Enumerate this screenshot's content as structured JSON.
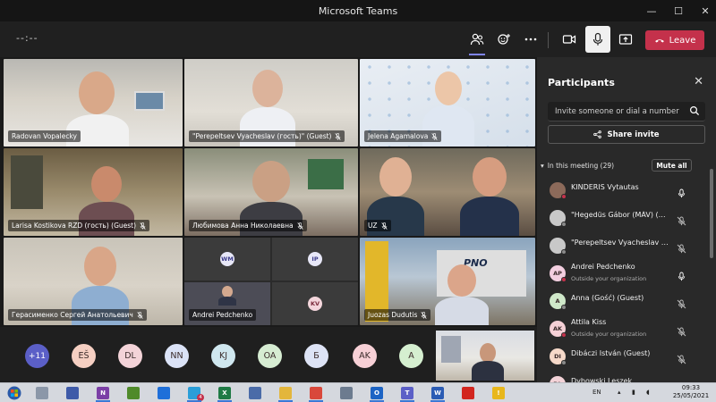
{
  "window": {
    "title": "Microsoft Teams",
    "controls": {
      "minimize": "—",
      "maximize": "☐",
      "close": "✕"
    }
  },
  "toolbar": {
    "timer": "--:--",
    "leave_label": "Leave",
    "icons": [
      "participants-icon",
      "reactions-icon",
      "more-icon",
      "camera-icon",
      "microphone-icon",
      "share-screen-icon"
    ]
  },
  "tiles": [
    {
      "name": "Radovan Vopalecky",
      "muted": false
    },
    {
      "name": "\"Perepeltsev Vyacheslav (гость)\" (Guest)",
      "muted": true
    },
    {
      "name": "Jelena Agamalova",
      "muted": true
    },
    {
      "name": "Larisa Kostikova RZD (гость) (Guest)",
      "muted": true
    },
    {
      "name": "Любимова Анна Николаевна",
      "muted": true
    },
    {
      "name": "UZ",
      "muted": true
    },
    {
      "name": "Герасименко Сергей Анатольевич",
      "muted": true
    },
    {
      "name": "Andrei Pedchenko",
      "muted": false
    },
    {
      "name": "Juozas Dudutis",
      "muted": true
    }
  ],
  "mini_tiles": [
    "WM",
    "IP",
    "KV"
  ],
  "pno_logo": "PNO",
  "strip": [
    {
      "initials": "+11",
      "color": "#5b5fc7"
    },
    {
      "initials": "EŠ",
      "color": "#f5cfc2"
    },
    {
      "initials": "DL",
      "color": "#f3d3d8"
    },
    {
      "initials": "NN",
      "color": "#dbe3f7"
    },
    {
      "initials": "KJ",
      "color": "#cfe7ef"
    },
    {
      "initials": "OA",
      "color": "#d6ecd2"
    },
    {
      "initials": "Б",
      "color": "#dde3f5"
    },
    {
      "initials": "AK",
      "color": "#f7d0d6"
    },
    {
      "initials": "A",
      "color": "#d5efd0"
    }
  ],
  "panel": {
    "title": "Participants",
    "search_placeholder": "Invite someone or dial a number",
    "share_invite": "Share invite",
    "section_label": "In this meeting (29)",
    "mute_all": "Mute all",
    "participants": [
      {
        "name": "KINDERIS Vytautas",
        "sub": "",
        "initials": "",
        "avatar_color": "#8c6a5a",
        "dot": "#c4314b",
        "mic": "on"
      },
      {
        "name": "\"Hegedüs Gábor (MÁV) (G…",
        "sub": "",
        "initials": "",
        "avatar_color": "#c8c8c8",
        "dot": "#8a8a8a",
        "mic": "off"
      },
      {
        "name": "\"Perepeltsev Vyacheslav (г…",
        "sub": "",
        "initials": "",
        "avatar_color": "#c8c8c8",
        "dot": "#8a8a8a",
        "mic": "off"
      },
      {
        "name": "Andrei Pedchenko",
        "sub": "Outside your organization",
        "initials": "AP",
        "avatar_color": "#f3cfe0",
        "dot": "#c4314b",
        "mic": "on"
      },
      {
        "name": "Anna (Gość) (Guest)",
        "sub": "",
        "initials": "A",
        "avatar_color": "#cfe8c9",
        "dot": "#8a8a8a",
        "mic": "off"
      },
      {
        "name": "Attila Kiss",
        "sub": "Outside your organization",
        "initials": "AK",
        "avatar_color": "#f5d0d6",
        "dot": "#c4314b",
        "mic": "off"
      },
      {
        "name": "Dibáczi István (Guest)",
        "sub": "",
        "initials": "DI",
        "avatar_color": "#f6d9c9",
        "dot": "#8a8a8a",
        "mic": "off"
      },
      {
        "name": "Dybowski Leszek",
        "sub": "",
        "initials": "DL",
        "avatar_color": "#f3d3d8",
        "dot": "#8a8a8a",
        "mic": "off"
      }
    ]
  },
  "taskbar": {
    "apps": [
      {
        "icon": "file-cabinet-icon",
        "color": "#8b97a8",
        "label": "",
        "running": false
      },
      {
        "icon": "network-icon",
        "color": "#3e5aa8",
        "label": "",
        "running": false
      },
      {
        "icon": "onenote-icon",
        "color": "#7b3fa6",
        "label": "N",
        "running": true
      },
      {
        "icon": "game-icon",
        "color": "#4f8a2a",
        "label": "",
        "running": false
      },
      {
        "icon": "teamviewer-icon",
        "color": "#1e6fd9",
        "label": "",
        "running": false
      },
      {
        "icon": "telegram-icon",
        "color": "#2a9ed8",
        "label": "",
        "running": true,
        "badge": "4"
      },
      {
        "icon": "excel-icon",
        "color": "#1f7a45",
        "label": "X",
        "running": true
      },
      {
        "icon": "photos-icon",
        "color": "#4a6ba8",
        "label": "",
        "running": false
      },
      {
        "icon": "explorer-icon",
        "color": "#e3b63c",
        "label": "",
        "running": true
      },
      {
        "icon": "chrome-icon",
        "color": "#d9483b",
        "label": "",
        "running": true
      },
      {
        "icon": "network-drive-icon",
        "color": "#6c7b8f",
        "label": "",
        "running": false
      },
      {
        "icon": "outlook-icon",
        "color": "#1d64c4",
        "label": "O",
        "running": true
      },
      {
        "icon": "teams-icon",
        "color": "#5b5fc7",
        "label": "T",
        "running": true
      },
      {
        "icon": "word-icon",
        "color": "#2b5cb4",
        "label": "W",
        "running": true
      },
      {
        "icon": "acrobat-icon",
        "color": "#d2261f",
        "label": "",
        "running": false
      },
      {
        "icon": "warning-icon",
        "color": "#e8b71c",
        "label": "!",
        "running": false
      }
    ],
    "language": "EN",
    "time": "09:33",
    "date": "25/05/2021"
  }
}
